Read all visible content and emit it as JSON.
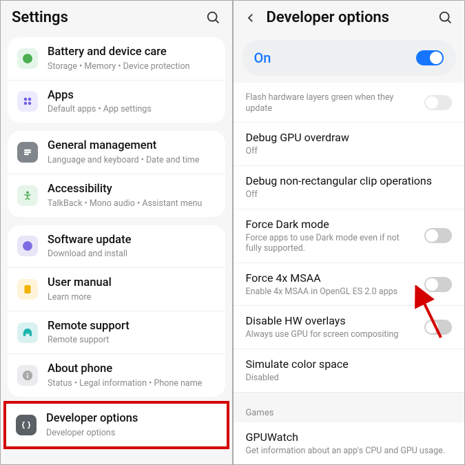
{
  "left": {
    "title": "Settings",
    "groups": [
      {
        "items": [
          {
            "title": "Battery and device care",
            "sub": "Storage  •  Memory  •  Device protection"
          },
          {
            "title": "Apps",
            "sub": "Default apps  •  App settings"
          }
        ]
      },
      {
        "items": [
          {
            "title": "General management",
            "sub": "Language and keyboard  •  Date and time"
          },
          {
            "title": "Accessibility",
            "sub": "TalkBack  •  Mono audio  •  Assistant menu"
          }
        ]
      },
      {
        "items": [
          {
            "title": "Software update",
            "sub": "Download and install"
          },
          {
            "title": "User manual",
            "sub": "Learn more"
          },
          {
            "title": "Remote support",
            "sub": "Remote support"
          },
          {
            "title": "About phone",
            "sub": "Status  •  Legal information  •  Phone name"
          }
        ]
      }
    ],
    "highlighted": {
      "title": "Developer options",
      "sub": "Developer options"
    }
  },
  "right": {
    "title": "Developer options",
    "master": "On",
    "options": [
      {
        "title": "",
        "sub": "Flash hardware layers green when they update",
        "toggle": "off",
        "disabled": true
      },
      {
        "title": "Debug GPU overdraw",
        "sub": "Off"
      },
      {
        "title": "Debug non-rectangular clip operations",
        "sub": "Off"
      },
      {
        "title": "Force Dark mode",
        "sub": "Force apps to use Dark mode even if not fully supported.",
        "toggle": "off"
      },
      {
        "title": "Force 4x MSAA",
        "sub": "Enable 4x MSAA in OpenGL ES 2.0 apps",
        "toggle": "off"
      },
      {
        "title": "Disable HW overlays",
        "sub": "Always use GPU for screen compositing",
        "toggle": "off"
      },
      {
        "title": "Simulate color space",
        "sub": "Disabled"
      }
    ],
    "section_label": "Games",
    "games_item": {
      "title": "GPUWatch",
      "sub": "Get information about an app's CPU and GPU usage."
    }
  }
}
